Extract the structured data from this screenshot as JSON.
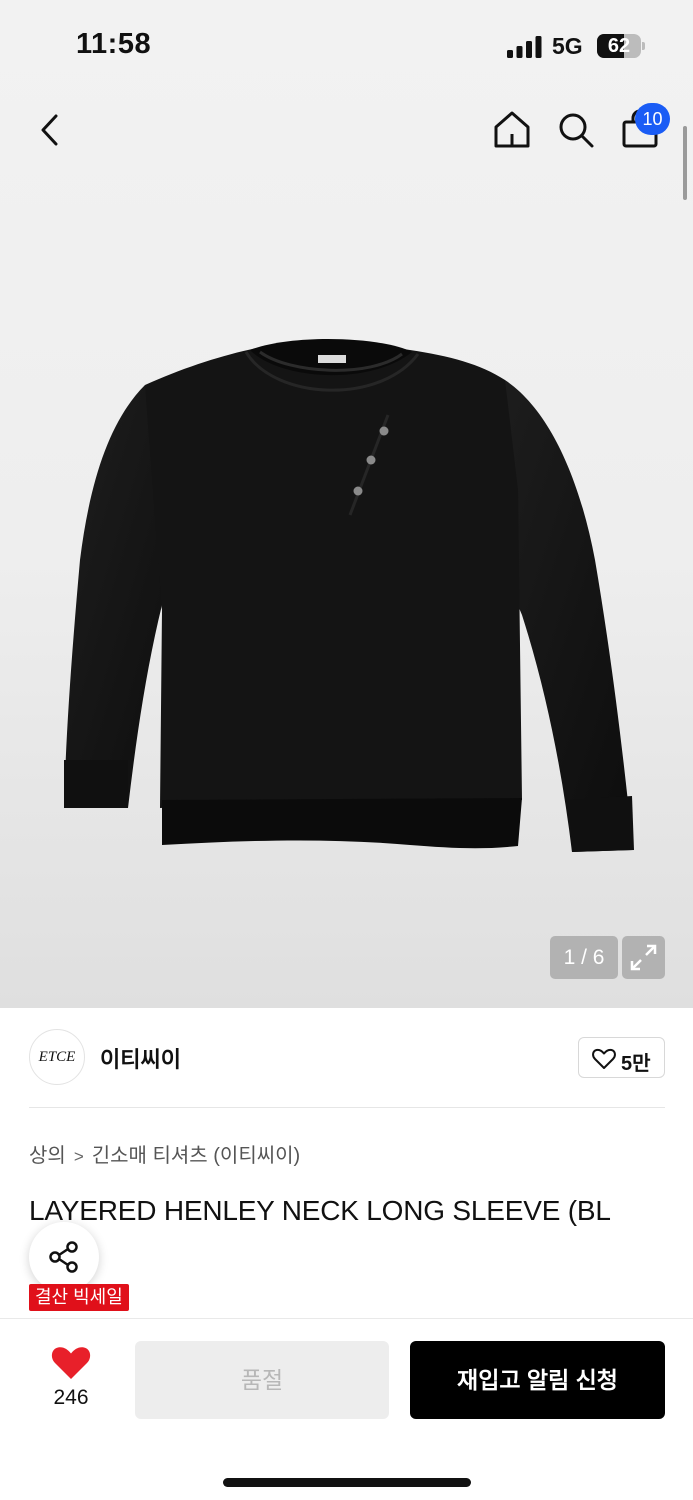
{
  "status": {
    "time": "11:58",
    "network": "5G",
    "battery": "62",
    "battery_level": 0.62
  },
  "nav": {
    "cart_count": "10"
  },
  "gallery": {
    "counter": "1 / 6"
  },
  "brand": {
    "logo_text": "ETCE",
    "name": "이티씨이",
    "likes": "5만"
  },
  "breadcrumb": {
    "category": "상의",
    "separator": ">",
    "subcategory": "긴소매 티셔츠 (이티씨이)"
  },
  "product": {
    "title": "LAYERED HENLEY NECK LONG SLEEVE (BL",
    "title_tail": ")",
    "sale_badge": "결산 빅세일"
  },
  "bottom": {
    "heart_count": "246",
    "sold_out_label": "품절",
    "restock_label": "재입고 알림 신청"
  },
  "colors": {
    "accent_blue": "#1a5cf5",
    "sale_red": "#e0101a",
    "heart_red": "#e8202a",
    "primary_black": "#000000"
  }
}
